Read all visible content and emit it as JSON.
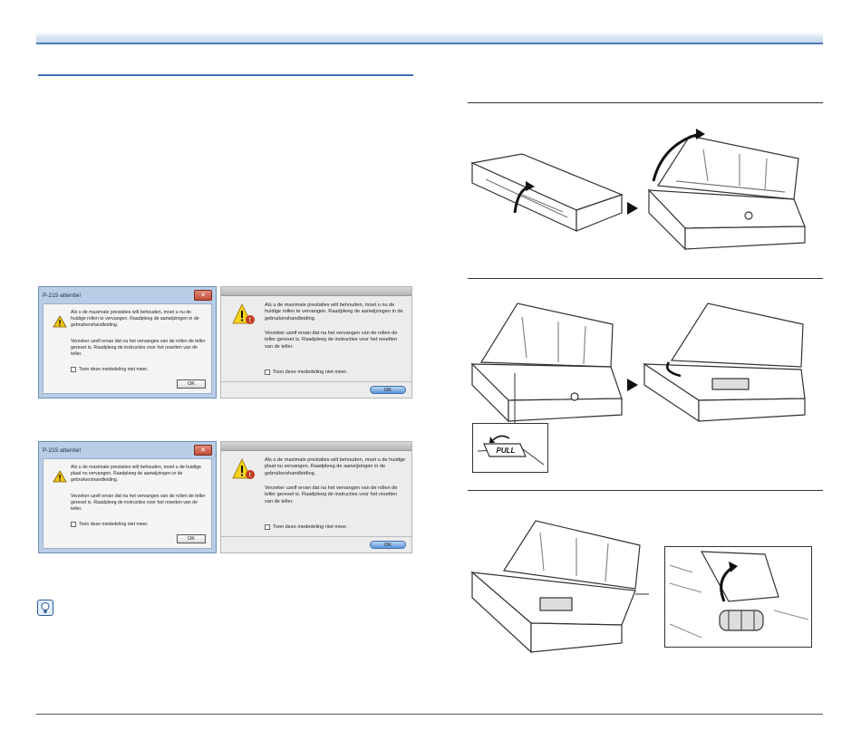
{
  "dialogs": {
    "win1": {
      "title": "P-215 attentie!",
      "close": "✕",
      "text1": "Als u de maximale prestaties wilt behouden, moet u nu de huidige rollen te vervangen. Raadpleeg de aanwijzingen in de gebruikershandleiding.",
      "text2": "Verzeker uzelf ervan dat na het vervangen van de rollen de teller gereset is. Raadpleeg de instructies voor het resetten van de teller.",
      "checkbox": "Toon deze mededeling niet meer.",
      "ok": "OK"
    },
    "mac1": {
      "text1": "Als u de maximale prestaties wilt behouden, moet u nu de huidige rollen te vervangen. Raadpleeg de aanwijzingen in de gebruikershandleiding.",
      "text2": "Verzeker uzelf ervan dat na het vervangen van de rollen de teller gereset is. Raadpleeg de instructies voor het resetten van de teller.",
      "checkbox": "Toon deze mededeling niet meer.",
      "ok": "OK"
    },
    "win2": {
      "title": "P-215 attentie!",
      "close": "✕",
      "text1": "Als u de maximale prestaties wilt behouden, moet u de huidige plaat nu vervangen. Raadpleeg de aanwijzingen in de gebruikershandleiding.",
      "text2": "Verzeker uzelf ervan dat na het vervangen van de rollen de teller gereset is. Raadpleeg de instructies voor het resetten van de teller.",
      "checkbox": "Toon deze mededeling niet meer.",
      "ok": "OK"
    },
    "mac2": {
      "text1": "Als u de maximale prestaties wilt behouden, moet u de huidige plaat nu vervangen. Raadpleeg de aanwijzingen in de gebruikershandleiding.",
      "text2": "Verzeker uzelf ervan dat na het vervangen van de rollen de teller gereset is. Raadpleeg de instructies voor het resetten van de teller.",
      "checkbox": "Toon deze mededeling niet meer.",
      "ok": "OK"
    }
  },
  "figures": {
    "pull_label": "PULL"
  },
  "colors": {
    "accent": "#3d6fb6",
    "warning": "#e8b800"
  }
}
